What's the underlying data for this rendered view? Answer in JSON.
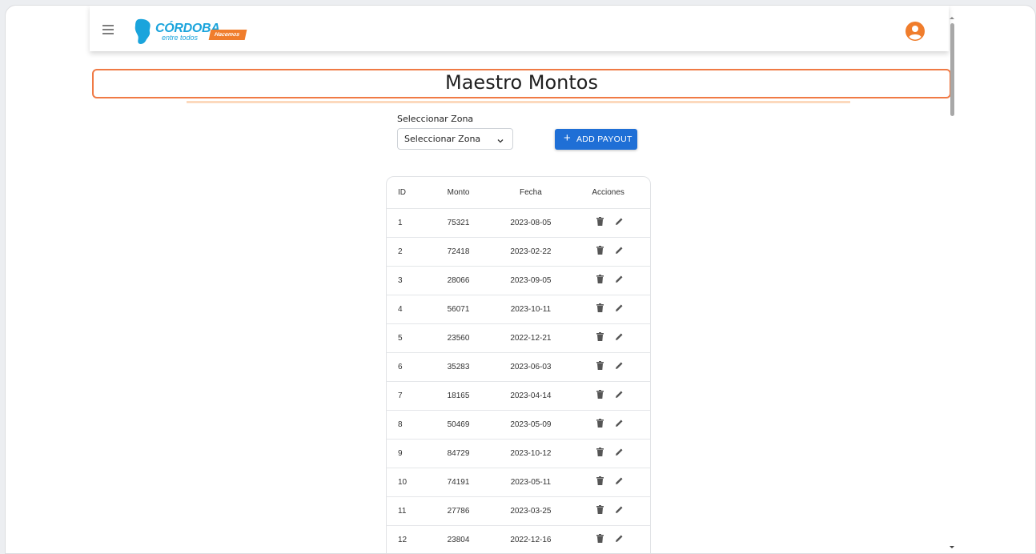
{
  "header": {
    "logo_main": "CÓRDOBA",
    "logo_sub": "entre todos",
    "logo_tag": "Hacemos"
  },
  "page": {
    "title": "Maestro Montos"
  },
  "filter": {
    "label": "Seleccionar Zona",
    "selected": "Seleccionar Zona"
  },
  "actions": {
    "add_label": "ADD PAYOUT",
    "add_icon": "+"
  },
  "table": {
    "headers": {
      "id": "ID",
      "monto": "Monto",
      "fecha": "Fecha",
      "acciones": "Acciones"
    },
    "rows": [
      {
        "id": "1",
        "monto": "75321",
        "fecha": "2023-08-05"
      },
      {
        "id": "2",
        "monto": "72418",
        "fecha": "2023-02-22"
      },
      {
        "id": "3",
        "monto": "28066",
        "fecha": "2023-09-05"
      },
      {
        "id": "4",
        "monto": "56071",
        "fecha": "2023-10-11"
      },
      {
        "id": "5",
        "monto": "23560",
        "fecha": "2022-12-21"
      },
      {
        "id": "6",
        "monto": "35283",
        "fecha": "2023-06-03"
      },
      {
        "id": "7",
        "monto": "18165",
        "fecha": "2023-04-14"
      },
      {
        "id": "8",
        "monto": "50469",
        "fecha": "2023-05-09"
      },
      {
        "id": "9",
        "monto": "84729",
        "fecha": "2023-10-12"
      },
      {
        "id": "10",
        "monto": "74191",
        "fecha": "2023-05-11"
      },
      {
        "id": "11",
        "monto": "27786",
        "fecha": "2023-03-25"
      },
      {
        "id": "12",
        "monto": "23804",
        "fecha": "2022-12-16"
      }
    ]
  },
  "colors": {
    "accent_orange": "#f07a45",
    "primary_blue": "#1f6fd6",
    "brand_blue": "#1aa4dc"
  }
}
